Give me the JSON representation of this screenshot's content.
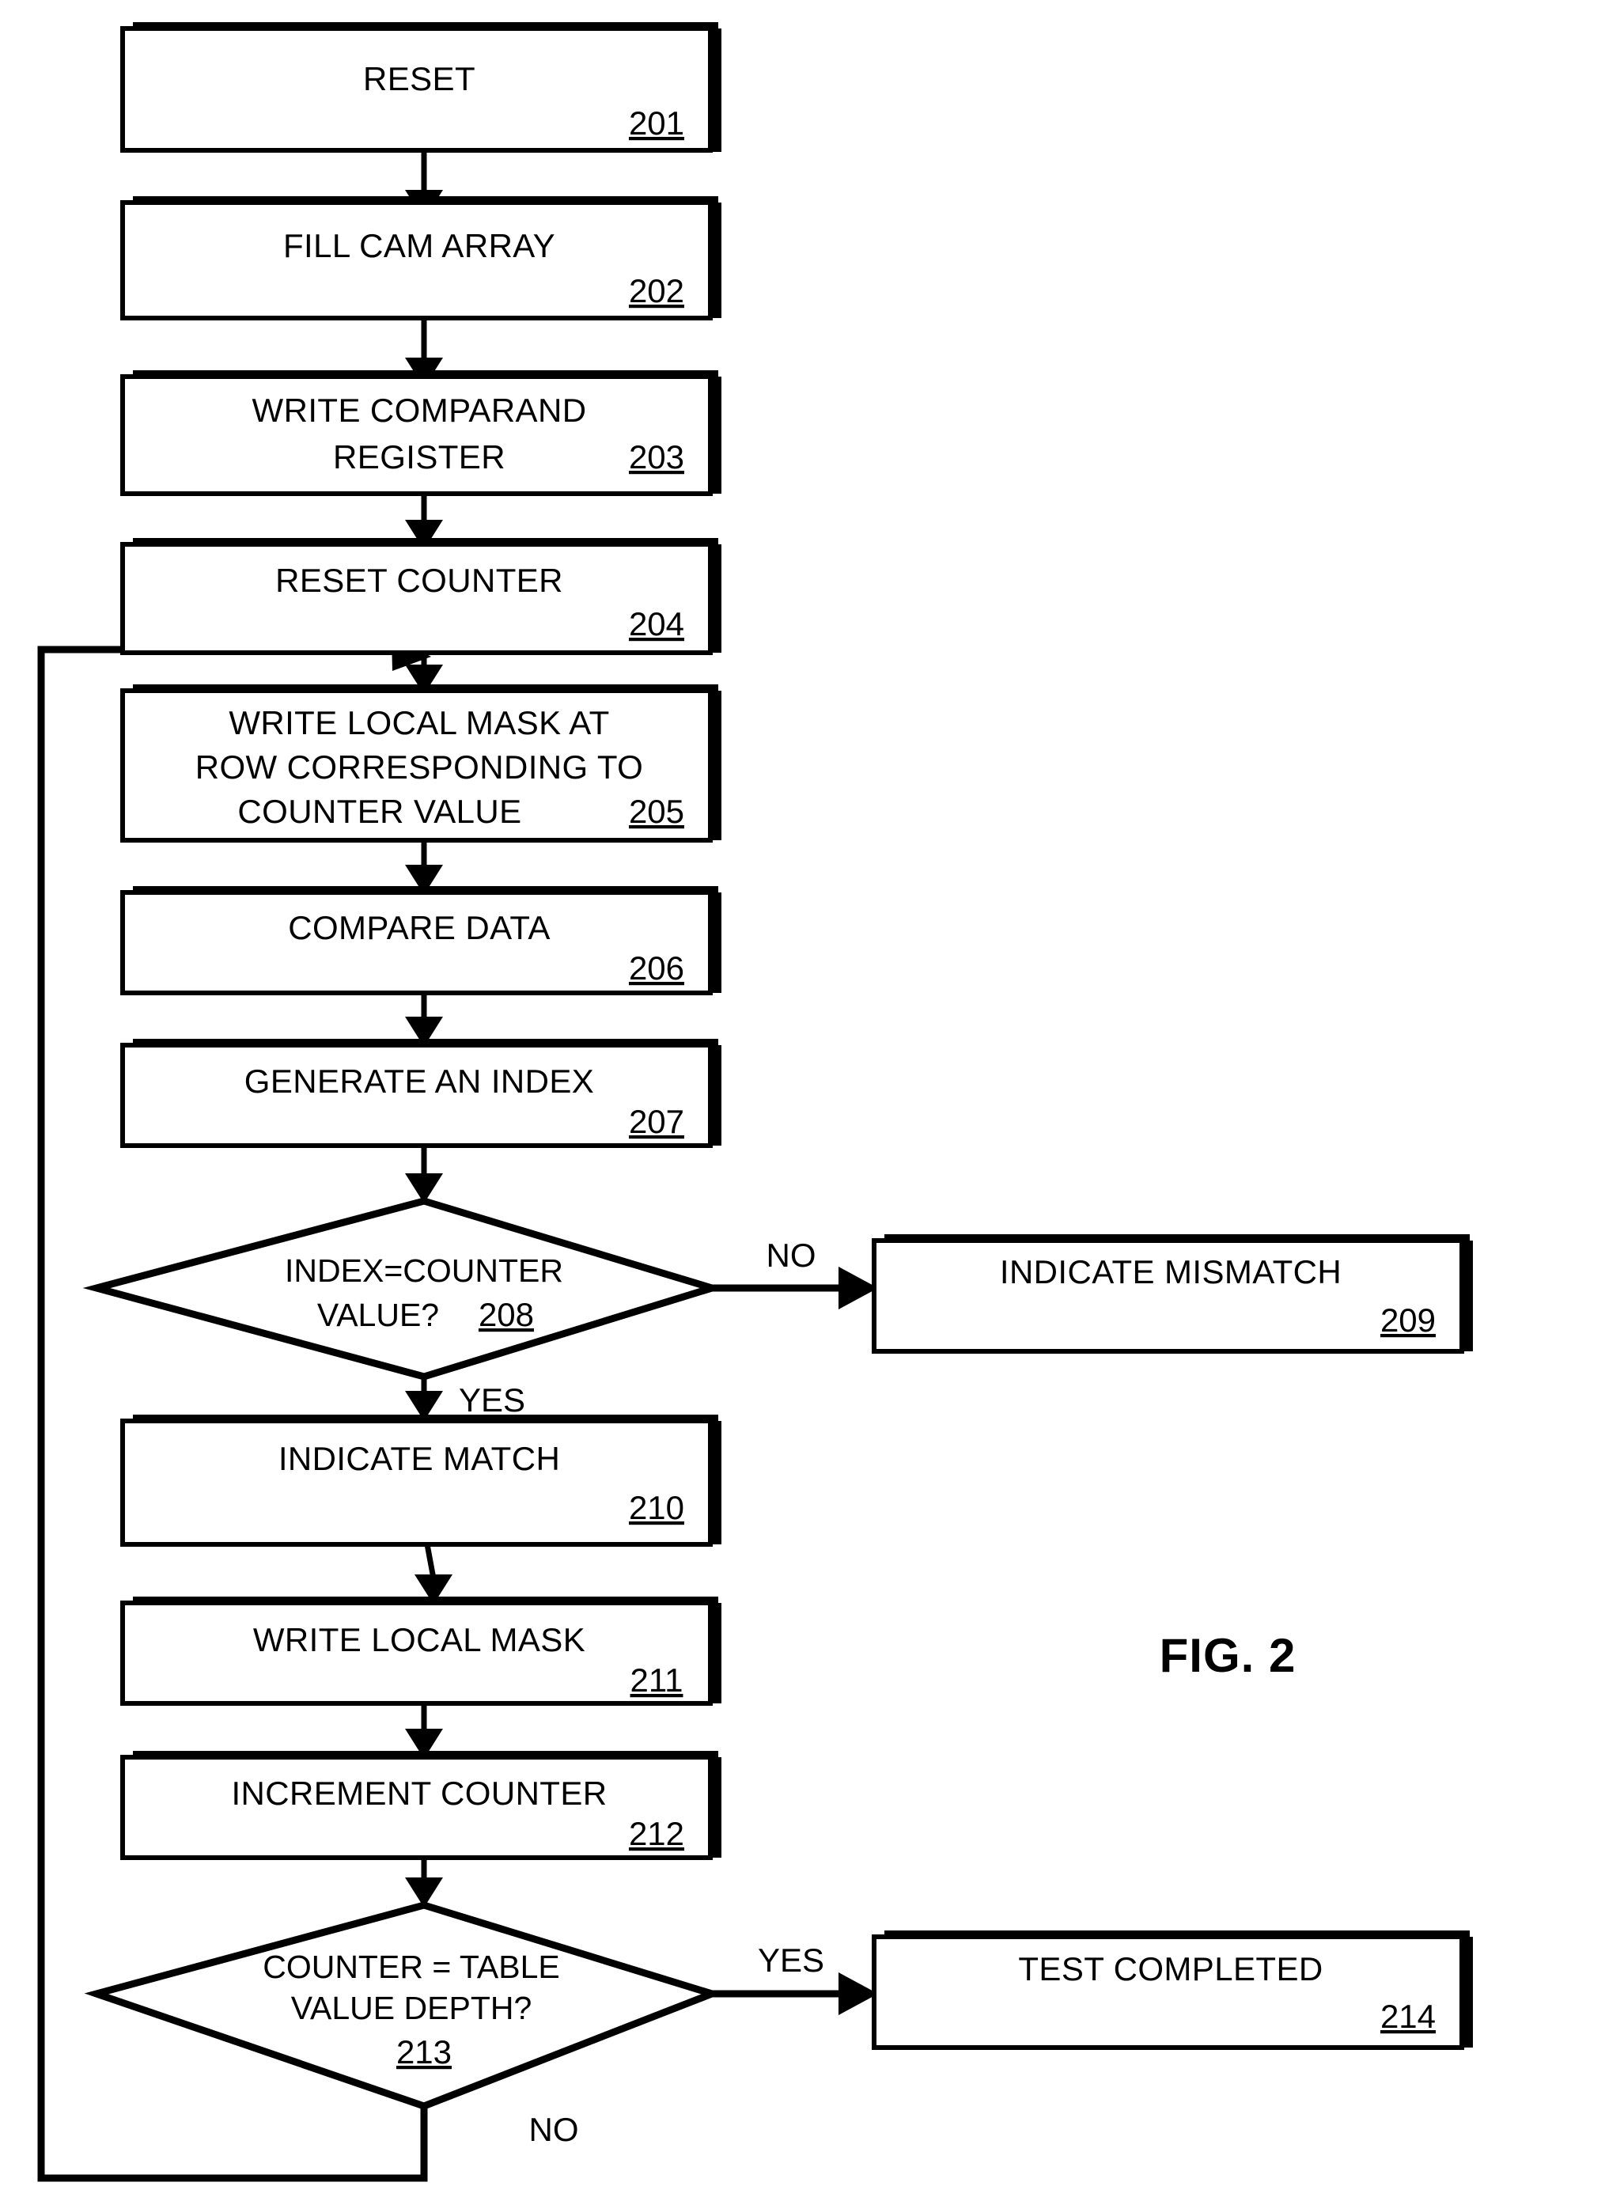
{
  "figure": {
    "label": "FIG. 2"
  },
  "nodes": [
    {
      "id": "n201",
      "type": "process",
      "ref": "201",
      "lines": [
        "RESET"
      ]
    },
    {
      "id": "n202",
      "type": "process",
      "ref": "202",
      "lines": [
        "FILL CAM ARRAY"
      ]
    },
    {
      "id": "n203",
      "type": "process",
      "ref": "203",
      "lines": [
        "WRITE COMPARAND",
        "REGISTER"
      ]
    },
    {
      "id": "n204",
      "type": "process",
      "ref": "204",
      "lines": [
        "RESET COUNTER"
      ]
    },
    {
      "id": "n205",
      "type": "process",
      "ref": "205",
      "lines": [
        "WRITE LOCAL MASK AT",
        "ROW CORRESPONDING TO",
        "COUNTER VALUE"
      ]
    },
    {
      "id": "n206",
      "type": "process",
      "ref": "206",
      "lines": [
        "COMPARE DATA"
      ]
    },
    {
      "id": "n207",
      "type": "process",
      "ref": "207",
      "lines": [
        "GENERATE AN INDEX"
      ]
    },
    {
      "id": "n208",
      "type": "decision",
      "ref": "208",
      "lines": [
        "INDEX=COUNTER",
        "VALUE?"
      ]
    },
    {
      "id": "n209",
      "type": "process",
      "ref": "209",
      "lines": [
        "INDICATE MISMATCH"
      ]
    },
    {
      "id": "n210",
      "type": "process",
      "ref": "210",
      "lines": [
        "INDICATE MATCH"
      ]
    },
    {
      "id": "n211",
      "type": "process",
      "ref": "211",
      "lines": [
        "WRITE LOCAL MASK"
      ]
    },
    {
      "id": "n212",
      "type": "process",
      "ref": "212",
      "lines": [
        "INCREMENT COUNTER"
      ]
    },
    {
      "id": "n213",
      "type": "decision",
      "ref": "213",
      "lines": [
        "COUNTER = TABLE",
        "VALUE    DEPTH?"
      ]
    },
    {
      "id": "n214",
      "type": "process",
      "ref": "214",
      "lines": [
        "TEST COMPLETED"
      ]
    }
  ],
  "branch_labels": {
    "d208_no": "NO",
    "d208_yes": "YES",
    "d213_yes": "YES",
    "d213_no": "NO"
  },
  "colors": {
    "stroke": "#000000",
    "fill": "#ffffff"
  }
}
